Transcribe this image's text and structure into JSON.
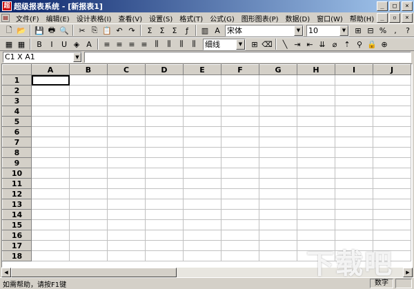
{
  "window": {
    "title": "超级报表系统 - [新报表1]",
    "controls": [
      "_",
      "□",
      "×"
    ]
  },
  "menubar": {
    "items": [
      "文件(F)",
      "编辑(E)",
      "设计表格(I)",
      "查看(V)",
      "设置(S)",
      "格式(T)",
      "公式(G)",
      "图形图表(P)",
      "数据(D)",
      "窗口(W)",
      "帮助(H)"
    ],
    "doc_controls": [
      "_",
      "▫",
      "×"
    ]
  },
  "toolbar1": {
    "buttons": [
      {
        "name": "new-icon",
        "glyph": "🗋"
      },
      {
        "name": "open-icon",
        "glyph": "📂"
      },
      {
        "name": "sep"
      },
      {
        "name": "save-icon",
        "glyph": "💾"
      },
      {
        "name": "print-icon",
        "glyph": "🖶"
      },
      {
        "name": "preview-icon",
        "glyph": "🔍"
      },
      {
        "name": "sep"
      },
      {
        "name": "cut-icon",
        "glyph": "✂"
      },
      {
        "name": "copy-icon",
        "glyph": "⎘"
      },
      {
        "name": "paste-icon",
        "glyph": "📋"
      },
      {
        "name": "undo-icon",
        "glyph": "↶"
      },
      {
        "name": "redo-icon",
        "glyph": "↷"
      },
      {
        "name": "sep"
      },
      {
        "name": "sum-icon",
        "glyph": "Σ"
      },
      {
        "name": "sum-row-icon",
        "glyph": "Σ"
      },
      {
        "name": "sum-col-icon",
        "glyph": "Σ"
      },
      {
        "name": "function-icon",
        "glyph": "ƒ"
      },
      {
        "name": "sep"
      },
      {
        "name": "chart-icon",
        "glyph": "▥"
      },
      {
        "name": "find-icon",
        "glyph": "A"
      }
    ],
    "font_name": "宋体",
    "font_size": "10",
    "right_buttons": [
      {
        "name": "merge-icon",
        "glyph": "⊞"
      },
      {
        "name": "split-icon",
        "glyph": "⊟"
      },
      {
        "name": "percent-icon",
        "glyph": "%"
      },
      {
        "name": "comma-icon",
        "glyph": ","
      },
      {
        "name": "help-icon",
        "glyph": "?"
      }
    ]
  },
  "toolbar2": {
    "buttons": [
      {
        "name": "sheet-icon",
        "glyph": "▦"
      },
      {
        "name": "grid-icon",
        "glyph": "▦"
      },
      {
        "name": "sep"
      },
      {
        "name": "bold-icon",
        "glyph": "B"
      },
      {
        "name": "italic-icon",
        "glyph": "I"
      },
      {
        "name": "underline-icon",
        "glyph": "U"
      },
      {
        "name": "fill-color-icon",
        "glyph": "◈"
      },
      {
        "name": "font-color-icon",
        "glyph": "A"
      },
      {
        "name": "sep"
      },
      {
        "name": "align-left-icon",
        "glyph": "≡"
      },
      {
        "name": "align-center-icon",
        "glyph": "≡"
      },
      {
        "name": "align-right-icon",
        "glyph": "≡"
      },
      {
        "name": "justify-icon",
        "glyph": "≡"
      },
      {
        "name": "distribute-icon",
        "glyph": "⫼"
      },
      {
        "name": "valign-top-icon",
        "glyph": "⫼"
      },
      {
        "name": "valign-mid-icon",
        "glyph": "⫼"
      },
      {
        "name": "valign-bottom-icon",
        "glyph": "⫼"
      }
    ],
    "line_style": "细线",
    "right_buttons": [
      {
        "name": "border-icon",
        "glyph": "⊞"
      },
      {
        "name": "erase-icon",
        "glyph": "⌫"
      },
      {
        "name": "sep"
      },
      {
        "name": "diagonal-icon",
        "glyph": "╲"
      },
      {
        "name": "insert-row-icon",
        "glyph": "⇥"
      },
      {
        "name": "delete-row-icon",
        "glyph": "⇤"
      },
      {
        "name": "insert-col-icon",
        "glyph": "⇊"
      },
      {
        "name": "eraser-icon",
        "glyph": "⌀"
      },
      {
        "name": "sort-asc-icon",
        "glyph": "⇡"
      },
      {
        "name": "filter-icon",
        "glyph": "⚲"
      },
      {
        "name": "lock-icon",
        "glyph": "🔒"
      },
      {
        "name": "zoom-icon",
        "glyph": "⊕"
      }
    ]
  },
  "formulabar": {
    "cell_ref": "C1 X A1",
    "formula": ""
  },
  "sheet": {
    "columns": [
      "A",
      "B",
      "C",
      "D",
      "E",
      "F",
      "G",
      "H",
      "I",
      "J"
    ],
    "rows": [
      "1",
      "2",
      "3",
      "4",
      "5",
      "6",
      "7",
      "8",
      "9",
      "10",
      "11",
      "12",
      "13",
      "14",
      "15",
      "16",
      "17",
      "18"
    ],
    "active_cell": "A1"
  },
  "statusbar": {
    "help_text": "如需帮助，请按F1键",
    "mode": "数字"
  },
  "watermark": "下载吧"
}
